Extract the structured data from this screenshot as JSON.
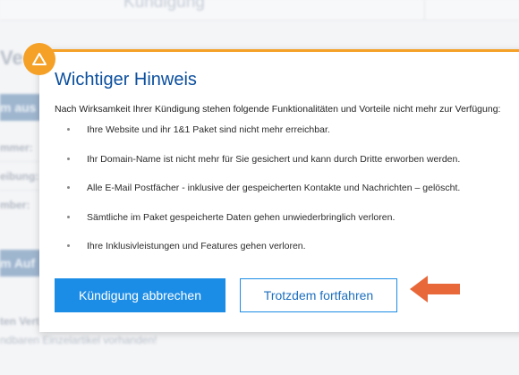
{
  "background": {
    "header_title": "Kündigung",
    "section_title": "Ve",
    "bar1_label": "m aus",
    "bar2_label": "m Auf",
    "labels": [
      "mmer:",
      "eibung:",
      "mber:"
    ],
    "footer_line1": "ten Vert",
    "footer_line2": "ndbaren Einzelartikel vorhanden!"
  },
  "modal": {
    "title": "Wichtiger Hinweis",
    "intro": "Nach Wirksamkeit Ihrer Kündigung stehen folgende Funktionalitäten und Vorteile nicht mehr zur Verfügung:",
    "items": [
      "Ihre Website und ihr 1&1 Paket sind nicht mehr erreichbar.",
      "Ihr Domain-Name ist nicht mehr für Sie gesichert und kann durch Dritte erworben werden.",
      "Alle E-Mail Postfächer - inklusive der gespeicherten Kontakte und Nachrichten – gelöscht.",
      "Sämtliche im Paket gespeicherte Daten gehen unwiederbringlich verloren.",
      "Ihre Inklusivleistungen und Features gehen verloren."
    ],
    "cancel_button": "Kündigung abbrechen",
    "continue_button": "Trotzdem fortfahren"
  },
  "colors": {
    "accent_orange": "#f5a026",
    "title_blue": "#0b4f9e",
    "primary_button": "#1c8de6",
    "annotation_arrow": "#e8683a"
  },
  "icons": {
    "warning": "warning-triangle-icon",
    "annotation": "arrow-left-icon"
  }
}
